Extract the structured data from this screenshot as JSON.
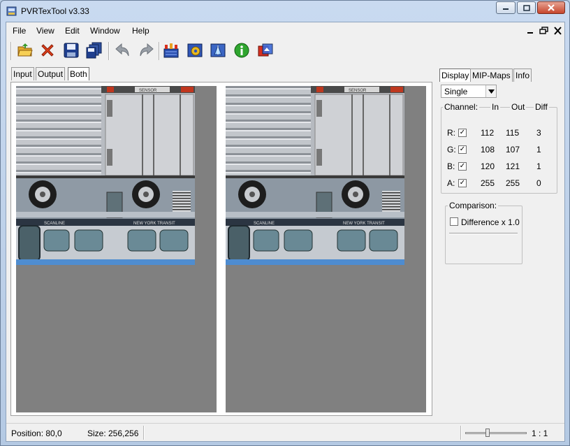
{
  "window": {
    "title": "PVRTexTool v3.33"
  },
  "menu": [
    "File",
    "View",
    "Edit",
    "Window",
    "Help"
  ],
  "toolbar_icons": [
    "open-folder-icon",
    "close-file-icon",
    "save-icon",
    "save-all-icon",
    "undo-icon",
    "redo-icon",
    "encode-icon",
    "settings-icon",
    "compress-icon",
    "info-icon",
    "preview-icon"
  ],
  "view_tabs": {
    "input": "Input",
    "output": "Output",
    "both": "Both",
    "active": "Both"
  },
  "side_tabs": {
    "display": "Display",
    "mipmaps": "MIP-Maps",
    "info": "Info",
    "active": "Display"
  },
  "display": {
    "mode": "Single",
    "channel_header": {
      "channel": "Channel:",
      "in": "In",
      "out": "Out",
      "diff": "Diff"
    },
    "channels": [
      {
        "label": "R:",
        "checked": true,
        "in": "112",
        "out": "115",
        "diff": "3"
      },
      {
        "label": "G:",
        "checked": true,
        "in": "108",
        "out": "107",
        "diff": "1"
      },
      {
        "label": "B:",
        "checked": true,
        "in": "120",
        "out": "121",
        "diff": "1"
      },
      {
        "label": "A:",
        "checked": true,
        "in": "255",
        "out": "255",
        "diff": "0"
      }
    ],
    "comparison": {
      "legend": "Comparison:",
      "difference_label": "Difference x 1.0",
      "checked": false
    }
  },
  "status": {
    "position": "Position: 80,0",
    "size": "Size: 256,256",
    "zoom": "1 : 1",
    "zoom_slider_value": 0.35
  },
  "texture_text": {
    "top_marking": "SENSOR",
    "bus_lettering": "SCANLINE",
    "bus_logo": "NEW YORK TRANSIT"
  }
}
